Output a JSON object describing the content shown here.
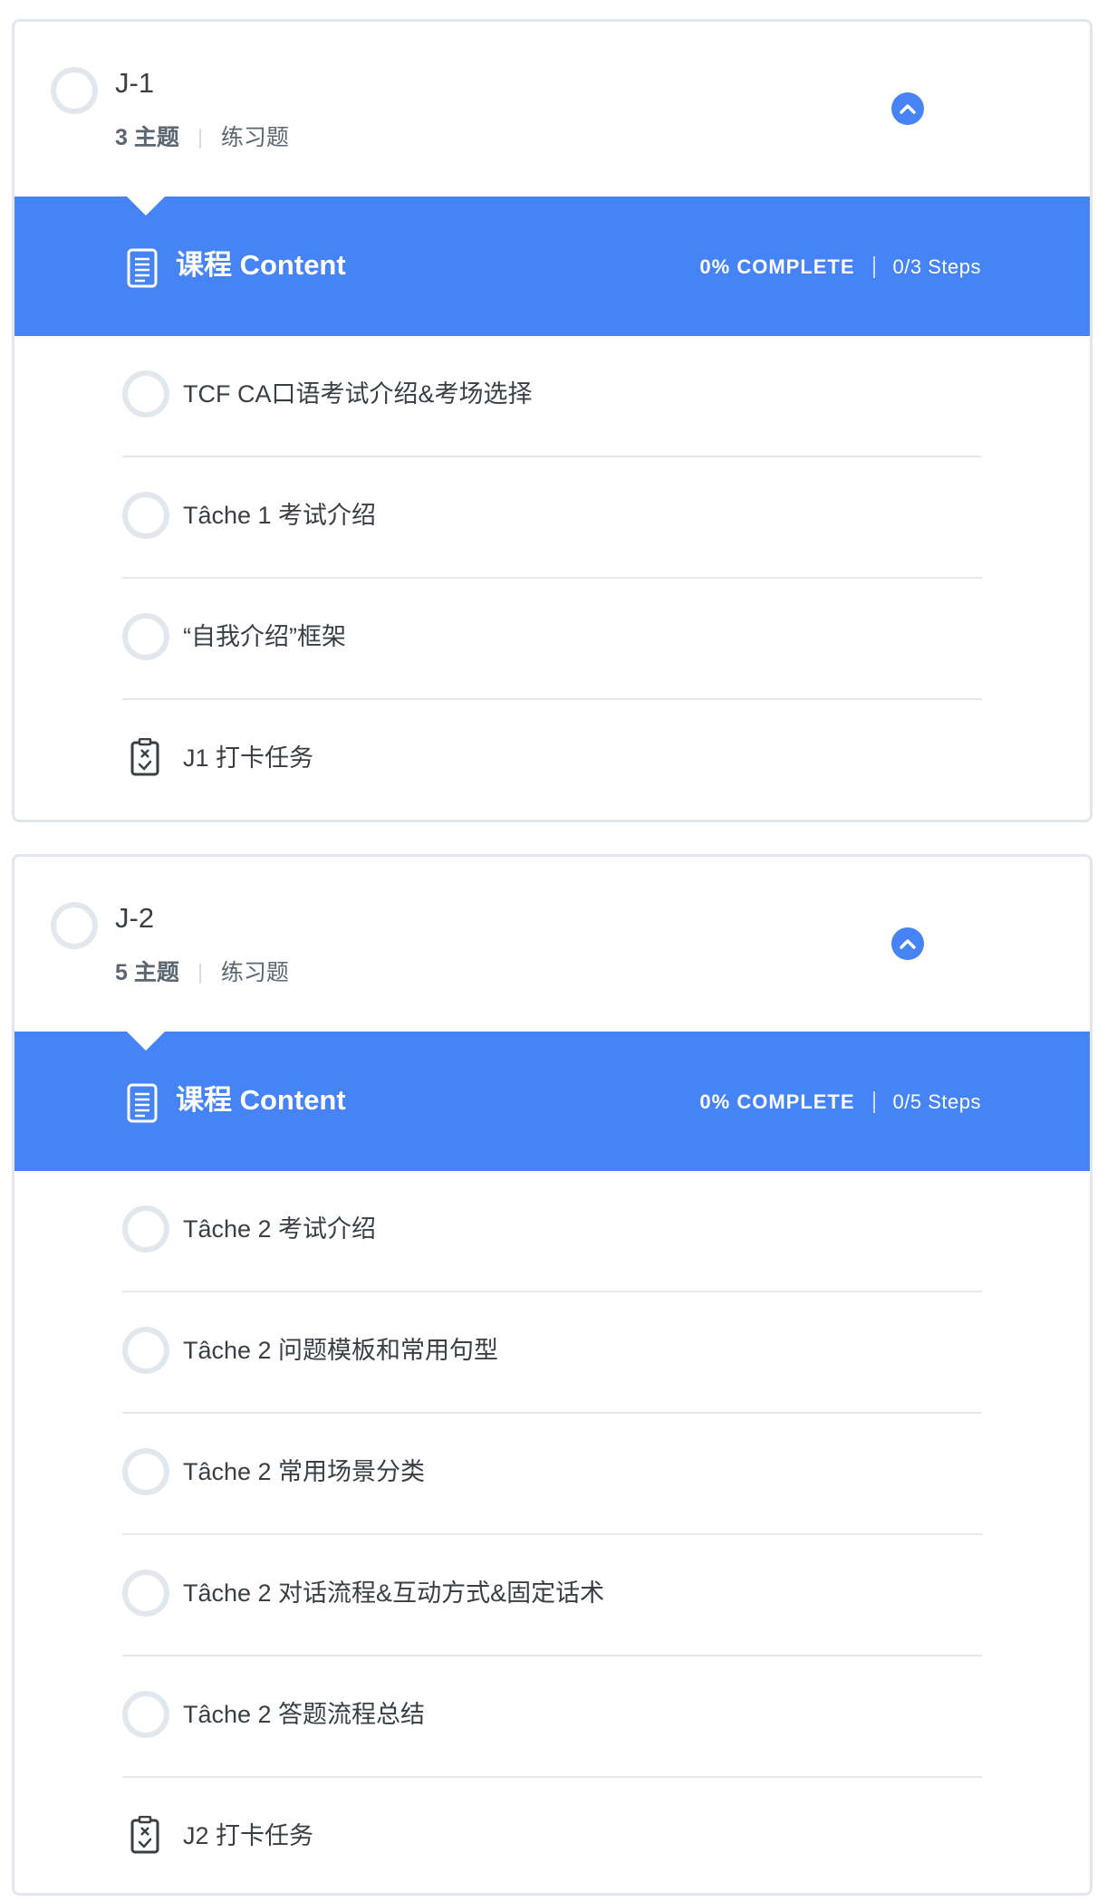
{
  "lessons": [
    {
      "title": "J-1",
      "topic_count": "3 主题",
      "type": "练习题",
      "content": {
        "title": "课程 Content",
        "percent": "0% COMPLETE",
        "steps": "0/3 Steps",
        "items": [
          {
            "label": "TCF CA口语考试介绍&考场选择"
          },
          {
            "label": "Tâche 1 考试介绍"
          },
          {
            "label": "“自我介绍”框架"
          },
          {
            "label": "J1 打卡任务"
          }
        ]
      }
    },
    {
      "title": "J-2",
      "topic_count": "5 主题",
      "type": "练习题",
      "content": {
        "title": "课程 Content",
        "percent": "0% COMPLETE",
        "steps": "0/5 Steps",
        "items": [
          {
            "label": "Tâche 2 考试介绍"
          },
          {
            "label": "Tâche 2 问题模板和常用句型"
          },
          {
            "label": "Tâche 2 常用场景分类"
          },
          {
            "label": "Tâche 2 对话流程&互动方式&固定话术"
          },
          {
            "label": "Tâche 2 答题流程总结"
          },
          {
            "label": "J2 打卡任务"
          }
        ]
      }
    }
  ]
}
